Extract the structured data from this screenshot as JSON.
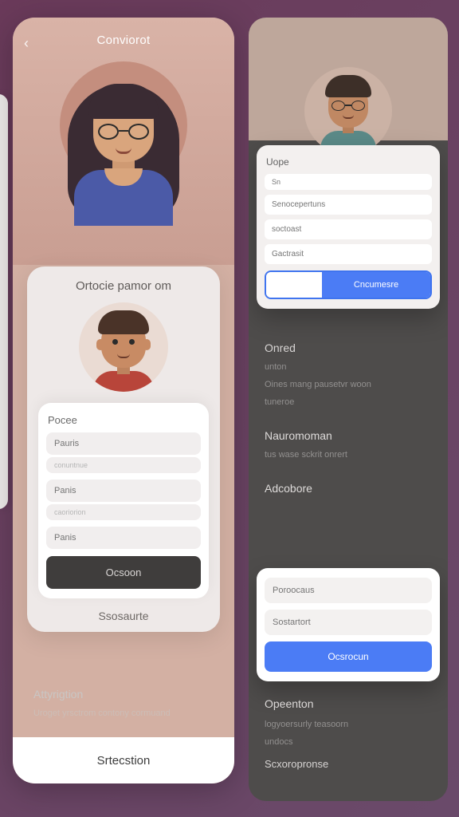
{
  "left": {
    "title": "Conviorot",
    "card_title": "Ortocie pamor om",
    "form_label": "Pocee",
    "fields": {
      "f1": "Pauris",
      "f1_sub": "conuntnue",
      "f2": "Panis",
      "f2_sub": "caoriorion",
      "f3": "Panis"
    },
    "primary_btn": "Ocsoon",
    "secondary_link": "Ssosaurte",
    "below": {
      "heading": "Attyrigtion",
      "sub": "Uroget yrsctrom contony cormuand"
    },
    "bottom_tab": "Srtecstion"
  },
  "right": {
    "card1": {
      "heading": "Uope",
      "f1": "Sn",
      "f2": "Senocepertuns",
      "f3": "soctoast",
      "f4": "Gactrasit",
      "cta": "Cncumesre"
    },
    "list": {
      "h1": "Onred",
      "i1": "unton",
      "i2": "Oines mang pausetvr woon",
      "i3": "tuneroe",
      "h2": "Nauromoman",
      "i4": "tus wase sckrit onrert",
      "h3": "Adcobore"
    },
    "card2": {
      "f1": "Poroocaus",
      "f2": "Sostartort",
      "btn": "Ocsrocun"
    },
    "tail": {
      "heading": "Opeenton",
      "i1": "logyoersurly teasoorn",
      "i2": "undocs",
      "last": "Scxoropronse"
    }
  }
}
